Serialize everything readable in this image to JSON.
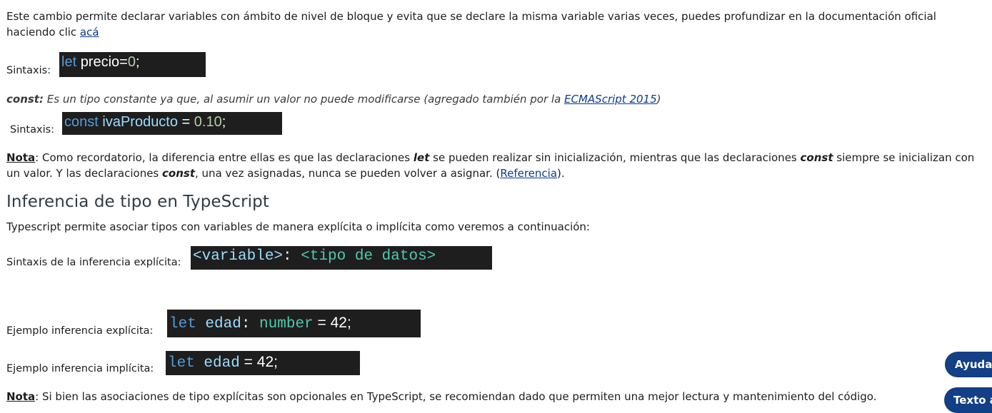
{
  "intro": {
    "text": "Este cambio permite declarar variables con ámbito de nivel de bloque y evita que se declare la misma variable varias veces, puedes profundizar en la documentación oficial haciendo clic ",
    "link": "acá"
  },
  "let_syntax": {
    "label": "Sintaxis:",
    "code_kw": "let",
    "code_id": "precio",
    "code_op": "=",
    "code_num": "0",
    "code_end": ";"
  },
  "const_desc": {
    "term": "const:",
    "text": " Es un tipo constante ya que, al asumir un valor no puede modificarse (agregado también por la ",
    "link": "ECMAScript 2015",
    "end": ")"
  },
  "const_syntax": {
    "label": "Sintaxis:",
    "code_kw": "const",
    "code_id": "ivaProducto",
    "code_op": " = ",
    "code_num": "0.10",
    "code_end": ";"
  },
  "note1": {
    "label": "Nota",
    "t1": ": Como recordatorio, la diferencia entre ellas es que las declaraciones ",
    "let": "let",
    "t2": " se pueden realizar sin inicialización, mientras que las declaraciones ",
    "const1": "const",
    "t3": " siempre se inicializan con un valor. Y las declaraciones ",
    "const2": "const",
    "t4": ", una vez asignadas, nunca se pueden volver a asignar. (",
    "link": "Referencia",
    "t5": ")."
  },
  "section": {
    "title": "Inferencia de tipo en TypeScript",
    "intro": "Typescript permite asociar tipos con variables de manera explícita o implícita como veremos a continuación:"
  },
  "explicit_syntax": {
    "label": "Sintaxis de la inferencia explícita:",
    "code_var": "<variable>",
    "code_colon": ": ",
    "code_type": "<tipo de datos>"
  },
  "explicit_example": {
    "label": "Ejemplo inferencia explícita:",
    "code_kw": "let",
    "code_id": " edad",
    "code_colon": ": ",
    "code_type": "number",
    "code_rest": " = 42;"
  },
  "implicit_example": {
    "label": "Ejemplo inferencia implícita:",
    "code_kw": "let",
    "code_id": " edad",
    "code_rest": " = 42;"
  },
  "note2": {
    "label": "Nota",
    "text": ": Si bien las asociaciones de tipo explícitas son opcionales en TypeScript, se recomiendan dado que permiten una mejor lectura y mantenimiento del código."
  },
  "buttons": {
    "help": "Ayuda",
    "text": "Texto a"
  }
}
